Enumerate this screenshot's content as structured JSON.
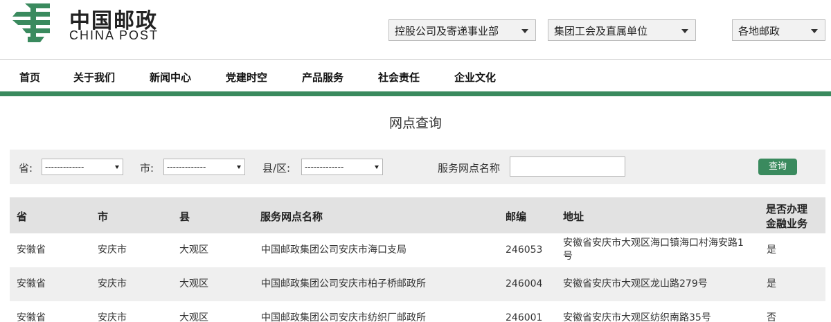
{
  "logo": {
    "cn": "中国邮政",
    "en": "CHINA POST",
    "brand_color": "#3a8a5e"
  },
  "top_selects": [
    {
      "label": "控股公司及寄递事业部"
    },
    {
      "label": "集团工会及直属单位"
    },
    {
      "label": "各地邮政"
    }
  ],
  "nav": [
    "首页",
    "关于我们",
    "新闻中心",
    "党建时空",
    "产品服务",
    "社会责任",
    "企业文化"
  ],
  "page_title": "网点查询",
  "query": {
    "province_label": "省:",
    "province_value": "-------------",
    "city_label": "市:",
    "city_value": "-------------",
    "county_label": "县/区:",
    "county_value": "-------------",
    "name_label": "服务网点名称",
    "name_value": "",
    "button": "查询"
  },
  "table": {
    "headers": [
      "省",
      "市",
      "县",
      "服务网点名称",
      "邮编",
      "地址",
      "是否办理",
      "金融业务"
    ],
    "rows": [
      [
        "安徽省",
        "安庆市",
        "大观区",
        "中国邮政集团公司安庆市海口支局",
        "246053",
        "安徽省安庆市大观区海口镇海口村海安路1",
        "号",
        "是"
      ],
      [
        "安徽省",
        "安庆市",
        "大观区",
        "中国邮政集团公司安庆市柏子桥邮政所",
        "246004",
        "安徽省安庆市大观区龙山路279号",
        "",
        "是"
      ],
      [
        "安徽省",
        "安庆市",
        "大观区",
        "中国邮政集团公司安庆市纺织厂邮政所",
        "246001",
        "安徽省安庆市大观区纺织南路35号",
        "",
        "否"
      ]
    ]
  }
}
